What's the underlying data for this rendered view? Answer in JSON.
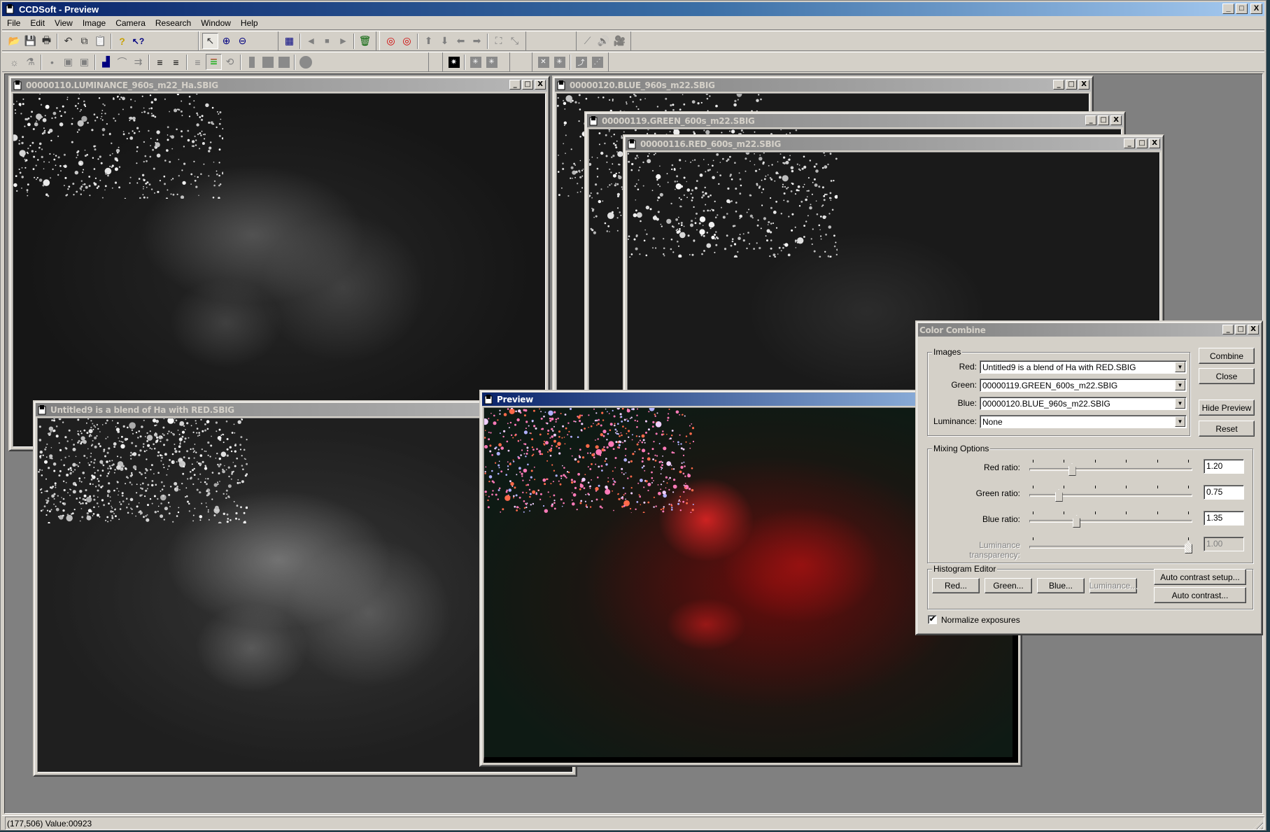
{
  "app": {
    "title": "CCDSoft  - Preview",
    "window_buttons": {
      "minimize": "_",
      "maximize": "□",
      "close": "X"
    }
  },
  "menu": [
    "File",
    "Edit",
    "View",
    "Image",
    "Camera",
    "Research",
    "Window",
    "Help"
  ],
  "toolbar1": [
    {
      "name": "open-icon",
      "glyph": "📂"
    },
    {
      "name": "save-icon",
      "glyph": "💾"
    },
    {
      "name": "print-icon",
      "glyph": "🖶"
    },
    {
      "name": "undo-icon",
      "glyph": "↶"
    },
    {
      "name": "copy-icon",
      "glyph": "⧉"
    },
    {
      "name": "paste-icon",
      "glyph": "📋"
    },
    {
      "name": "help-icon",
      "glyph": "?"
    },
    {
      "name": "context-help-icon",
      "glyph": "↖?"
    },
    {
      "name": "pointer-icon",
      "glyph": "↖"
    },
    {
      "name": "zoom-in-icon",
      "glyph": "⊕"
    },
    {
      "name": "zoom-out-icon",
      "glyph": "⊖"
    },
    {
      "name": "tile-icon",
      "glyph": "▦"
    },
    {
      "name": "previous-icon",
      "glyph": "◀"
    },
    {
      "name": "stop-icon",
      "glyph": "■"
    },
    {
      "name": "next-icon",
      "glyph": "▶"
    },
    {
      "name": "trash-icon",
      "glyph": "🗑"
    },
    {
      "name": "target-new-icon",
      "glyph": "◎"
    },
    {
      "name": "target-multi-icon",
      "glyph": "◎"
    },
    {
      "name": "arrow-up-icon",
      "glyph": "⬆"
    },
    {
      "name": "arrow-down-icon",
      "glyph": "⬇"
    },
    {
      "name": "arrow-left-icon",
      "glyph": "⬅"
    },
    {
      "name": "arrow-right-icon",
      "glyph": "➡"
    },
    {
      "name": "expand-icon",
      "glyph": "⛶"
    },
    {
      "name": "shrink-icon",
      "glyph": "⤡"
    },
    {
      "name": "telescope-icon",
      "glyph": "⟋"
    },
    {
      "name": "sound-icon",
      "glyph": "🔊"
    },
    {
      "name": "camera-icon",
      "glyph": "🎥"
    }
  ],
  "toolbar2": [
    {
      "name": "brightness-icon",
      "glyph": "☼"
    },
    {
      "name": "filter-icon",
      "glyph": "⚗"
    },
    {
      "name": "stars-icon",
      "glyph": "•"
    },
    {
      "name": "frame-icon",
      "glyph": "▣"
    },
    {
      "name": "frame-dot-icon",
      "glyph": "▣"
    },
    {
      "name": "histogram-icon",
      "glyph": "▟"
    },
    {
      "name": "curve-icon",
      "glyph": "⌒"
    },
    {
      "name": "transform-icon",
      "glyph": "⇉"
    },
    {
      "name": "stack-add-icon",
      "glyph": "≡"
    },
    {
      "name": "stack-subtract-icon",
      "glyph": "≡"
    },
    {
      "name": "stack-blend-icon",
      "glyph": "≡"
    },
    {
      "name": "color-combine-icon",
      "glyph": "≡"
    },
    {
      "name": "rotate-icon",
      "glyph": "⟲"
    },
    {
      "name": "bar-icon",
      "glyph": "▌"
    },
    {
      "name": "square-icon",
      "glyph": "■"
    },
    {
      "name": "square-2-icon",
      "glyph": "■"
    },
    {
      "name": "circle-icon",
      "glyph": "●"
    },
    {
      "name": "star-grid-icon",
      "glyph": "✷"
    },
    {
      "name": "star-box-icon",
      "glyph": "✳"
    },
    {
      "name": "star-box-2-icon",
      "glyph": "✳"
    },
    {
      "name": "star-x-icon",
      "glyph": "✕"
    },
    {
      "name": "star-box-3-icon",
      "glyph": "✳"
    },
    {
      "name": "line-curve-icon",
      "glyph": "⤴"
    },
    {
      "name": "line-dots-icon",
      "glyph": "⋰"
    }
  ],
  "windows": {
    "luminance": {
      "title": "00000110.LUMINANCE_960s_m22_Ha.SBIG"
    },
    "blue": {
      "title": "00000120.BLUE_960s_m22.SBIG"
    },
    "green": {
      "title": "00000119.GREEN_600s_m22.SBIG"
    },
    "red": {
      "title": "00000116.RED_600s_m22.SBIG"
    },
    "blend": {
      "title": "Untitled9 is a blend of Ha with RED.SBIG"
    },
    "preview": {
      "title": "Preview"
    }
  },
  "color_combine": {
    "title": "Color Combine",
    "images_group": "Images",
    "rows": [
      {
        "label": "Red:",
        "value": "Untitled9 is a blend of Ha with RED.SBIG"
      },
      {
        "label": "Green:",
        "value": "00000119.GREEN_600s_m22.SBIG"
      },
      {
        "label": "Blue:",
        "value": "00000120.BLUE_960s_m22.SBIG"
      },
      {
        "label": "Luminance:",
        "value": "None"
      }
    ],
    "buttons": {
      "combine": "Combine",
      "close": "Close",
      "hide_preview": "Hide Preview",
      "reset": "Reset"
    },
    "mixing_group": "Mixing Options",
    "sliders": [
      {
        "label": "Red ratio:",
        "value": "1.20",
        "position": 0.25,
        "enabled": true
      },
      {
        "label": "Green ratio:",
        "value": "0.75",
        "position": 0.165,
        "enabled": true
      },
      {
        "label": "Blue ratio:",
        "value": "1.35",
        "position": 0.28,
        "enabled": true
      },
      {
        "label": "Luminance transparency:",
        "value": "1.00",
        "position": 1.0,
        "enabled": false
      }
    ],
    "histogram_group": "Histogram Editor",
    "histogram_buttons": {
      "red": "Red...",
      "green": "Green...",
      "blue": "Blue...",
      "luminance": "Luminance...",
      "auto_contrast_setup": "Auto contrast setup...",
      "auto_contrast": "Auto contrast..."
    },
    "normalize": {
      "label": "Normalize exposures",
      "checked": true,
      "mark": "✔"
    }
  },
  "status": {
    "text": "(177,506) Value:00923"
  }
}
